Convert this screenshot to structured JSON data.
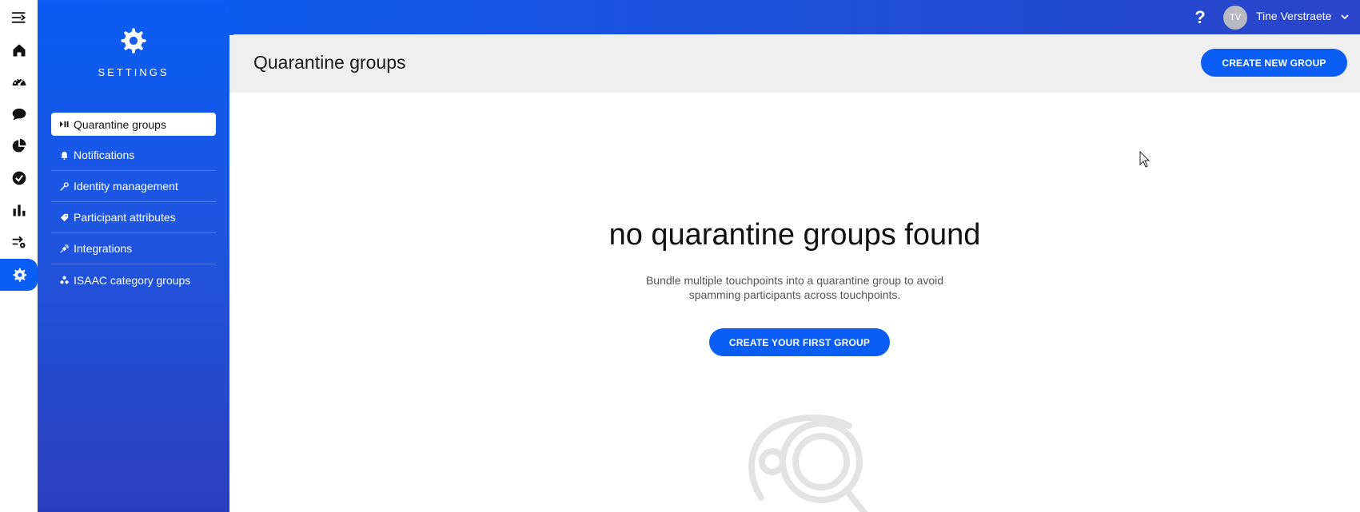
{
  "app": {
    "user_name": "Tine Verstraete",
    "user_initials": "TV",
    "help_label": "?"
  },
  "rail": {
    "items": [
      {
        "icon": "menu-collapse-icon"
      },
      {
        "icon": "home-icon"
      },
      {
        "icon": "dashboard-icon"
      },
      {
        "icon": "chat-icon"
      },
      {
        "icon": "pie-chart-icon"
      },
      {
        "icon": "check-circle-icon"
      },
      {
        "icon": "bar-chart-icon"
      },
      {
        "icon": "workflow-icon"
      },
      {
        "icon": "gear-icon",
        "active": true
      }
    ]
  },
  "sidebar": {
    "title": "SETTINGS",
    "items": [
      {
        "label": "Quarantine groups",
        "icon": "pause-play-icon",
        "active": true
      },
      {
        "label": "Notifications",
        "icon": "bell-icon"
      },
      {
        "label": "Identity management",
        "icon": "key-icon"
      },
      {
        "label": "Participant attributes",
        "icon": "tag-icon"
      },
      {
        "label": "Integrations",
        "icon": "plug-icon"
      },
      {
        "label": "ISAAC category groups",
        "icon": "category-groups-icon"
      }
    ]
  },
  "main": {
    "title": "Quarantine groups",
    "create_new_label": "CREATE NEW GROUP",
    "empty_title": "no quarantine groups found",
    "empty_description": "Bundle multiple touchpoints into a quarantine group to avoid spamming participants across touchpoints.",
    "create_first_label": "CREATE YOUR FIRST GROUP"
  },
  "colors": {
    "accent": "#0a5df5",
    "sidebar_bottom": "#2b3fbd",
    "header_bg": "#efefef"
  }
}
